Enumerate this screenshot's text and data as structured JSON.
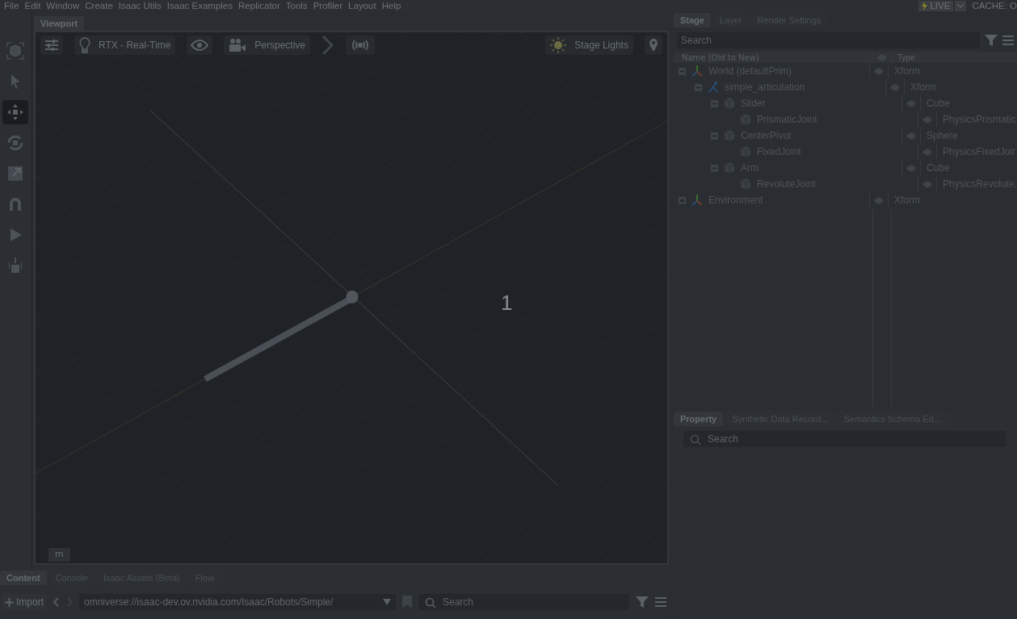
{
  "menu": [
    "File",
    "Edit",
    "Window",
    "Create",
    "Isaac Utils",
    "Isaac Examples",
    "Replicator",
    "Tools",
    "Profiler",
    "Layout",
    "Help"
  ],
  "status": {
    "live": "LIVE",
    "cache": "CACHE: O"
  },
  "tools": [
    {
      "selected": false
    },
    {
      "selected": false
    },
    {
      "selected": true
    },
    {
      "selected": false
    },
    {
      "selected": false
    },
    {
      "selected": false
    },
    {
      "selected": false
    },
    {
      "selected": false
    }
  ],
  "viewport": {
    "tab": "Viewport",
    "renderer": "RTX - Real-Time",
    "camera": "Perspective",
    "lights": "Stage Lights",
    "overlay_label": "1",
    "unit_button": "m"
  },
  "stage": {
    "tabs": [
      {
        "label": "Stage",
        "selected": true
      },
      {
        "label": "Layer",
        "selected": false
      },
      {
        "label": "Render Settings",
        "selected": false
      }
    ],
    "search": {
      "placeholder": "Search"
    },
    "columns": [
      "Name (Old to New)",
      "Type"
    ],
    "tree": [
      {
        "name": "World (defaultPrim)",
        "type": "Xform",
        "kind": "xform",
        "expanded": true,
        "children": [
          {
            "name": "simple_articulation",
            "type": "Xform",
            "kind": "articulation",
            "expanded": true,
            "children": [
              {
                "name": "Slider",
                "type": "Cube",
                "kind": "cube",
                "expanded": true,
                "children": [
                  {
                    "name": "PrismaticJoint",
                    "type": "PhysicsPrismatic",
                    "kind": "cube"
                  }
                ]
              },
              {
                "name": "CenterPivot",
                "type": "Sphere",
                "kind": "cube",
                "expanded": true,
                "children": [
                  {
                    "name": "FixedJoint",
                    "type": "PhysicsFixedJoir",
                    "kind": "cube"
                  }
                ]
              },
              {
                "name": "Arm",
                "type": "Cube",
                "kind": "cube",
                "expanded": true,
                "children": [
                  {
                    "name": "RevoluteJoint",
                    "type": "PhysicsRevolute.",
                    "kind": "cube"
                  }
                ]
              }
            ]
          }
        ]
      },
      {
        "name": "Environment",
        "type": "Xform",
        "kind": "xform",
        "expanded": false
      }
    ]
  },
  "property": {
    "tabs": [
      {
        "label": "Property",
        "selected": true
      },
      {
        "label": "Synthetic Data Record...",
        "selected": false
      },
      {
        "label": "Semantics Schema Ed...",
        "selected": false
      }
    ],
    "search": {
      "placeholder": "Search"
    }
  },
  "content": {
    "tabs": [
      {
        "label": "Content",
        "selected": true
      },
      {
        "label": "Console",
        "selected": false
      },
      {
        "label": "Isaac Assets (Beta)",
        "selected": false
      },
      {
        "label": "Flow",
        "selected": false
      }
    ],
    "import": "Import",
    "path": "omniverse://isaac-dev.ov.nvidia.com/Isaac/Robots/Simple/",
    "search": {
      "placeholder": "Search"
    }
  }
}
